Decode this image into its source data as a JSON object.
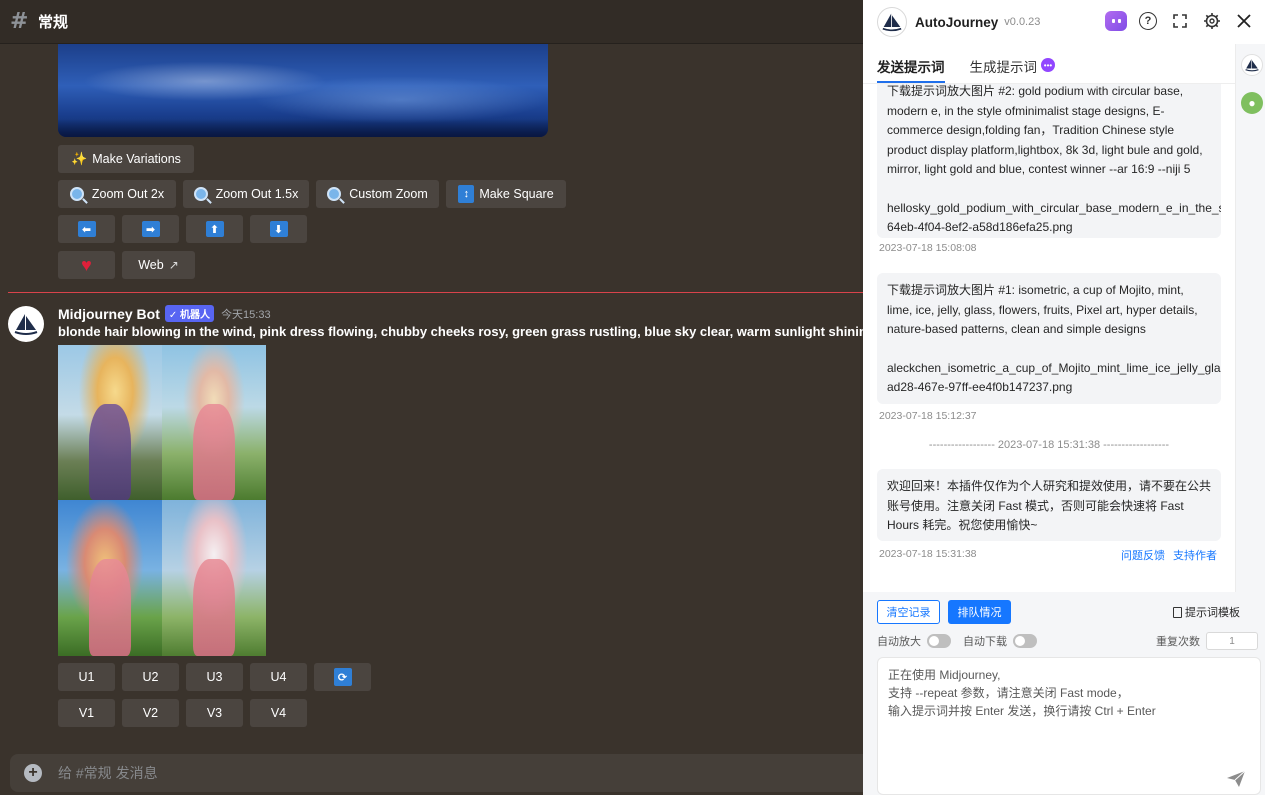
{
  "discord": {
    "channel": "常规",
    "buttons_top": {
      "make_variations": "Make Variations",
      "zoom_2x": "Zoom Out 2x",
      "zoom_15x": "Zoom Out 1.5x",
      "custom_zoom": "Custom Zoom",
      "make_square": "Make Square",
      "web": "Web"
    },
    "message": {
      "author": "Midjourney Bot",
      "badge": "✓ 机器人",
      "time": "今天15:33",
      "prompt": "blonde hair blowing in the wind, pink dress flowing, chubby cheeks rosy, green grass rustling, blue sky clear, warm sunlight shining"
    },
    "upscale": [
      "U1",
      "U2",
      "U3",
      "U4"
    ],
    "variation": [
      "V1",
      "V2",
      "V3",
      "V4"
    ],
    "composer_placeholder": "给 #常规 发消息"
  },
  "panel": {
    "title": "AutoJourney",
    "version": "v0.0.23",
    "tabs": [
      "发送提示词",
      "生成提示词"
    ],
    "cards": [
      {
        "text": "下载提示词放大图片 #2: gold podium with circular base, modern e, in the style ofminimalist stage designs, E-commerce design,folding fan，Tradition Chinese style product display platform,lightbox, 8k 3d, light bule and gold, mirror, light gold and blue, contest winner --ar 16:9 --niji 5",
        "file1": "hellosky_gold_podium_with_circular_base_modern_e_in_the_sty",
        "file2": "64eb-4f04-8ef2-a58d186efa25.png",
        "time": "2023-07-18 15:08:08"
      },
      {
        "text": "下载提示词放大图片 #1: isometric, a cup of Mojito, mint, lime, ice, jelly, glass, flowers, fruits, Pixel art, hyper details, nature-based patterns, clean and simple designs",
        "file1": "aleckchen_isometric_a_cup_of_Mojito_mint_lime_ice_jelly_glass",
        "file2": "ad28-467e-97ff-ee4f0b147237.png",
        "time": "2023-07-18 15:12:37"
      }
    ],
    "separator": "------------------ 2023-07-18 15:31:38 ------------------",
    "welcome": {
      "text": "欢迎回来！本插件仅作为个人研究和提效使用，请不要在公共账号使用。注意关闭 Fast 模式，否则可能会快速将 Fast Hours 耗完。祝您使用愉快~",
      "time": "2023-07-18 15:31:38",
      "feedback": "问题反馈",
      "support": "支持作者"
    },
    "controls": {
      "clear": "清空记录",
      "queue": "排队情况",
      "template": "提示词模板",
      "auto_upscale": "自动放大",
      "auto_download": "自动下载",
      "repeat_label": "重复次数",
      "repeat_value": "1"
    },
    "input_lines": [
      "正在使用 Midjourney,",
      "支持 --repeat 参数，请注意关闭 Fast mode，",
      "输入提示词并按 Enter 发送，换行请按 Ctrl + Enter"
    ]
  }
}
